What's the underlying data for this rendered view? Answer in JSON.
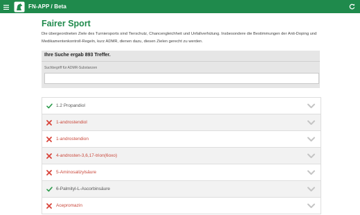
{
  "topbar": {
    "app_title": "FN-APP / Beta",
    "background": "#1f8a4c",
    "menu_icon": "hamburger-menu-icon",
    "logo_icon": "horse-logo-icon",
    "refresh_icon": "refresh-icon"
  },
  "main": {
    "title": "Fairer Sport",
    "intro": "Die übergeordneten Ziele des Turniersports sind Tierschutz, Chancengleichheit und Unfallverhütung. Insbesondere die Bestimmungen der Anti-Doping und Medikamentenkontroll-Regeln, kurz ADMR, dienen dazu, diesen Zielen gerecht zu werden."
  },
  "search": {
    "results_text": "Ihre Suche ergab 893 Treffer.",
    "label": "Suchbegriff für ADMR-Substanzen",
    "value": "",
    "placeholder": ""
  },
  "colors": {
    "allowed": "#2a9a4a",
    "banned": "#d9443a"
  },
  "substances": [
    {
      "name": "1.2 Propandiol",
      "status": "allowed"
    },
    {
      "name": "1-androstendiol",
      "status": "banned"
    },
    {
      "name": "1-androstendion",
      "status": "banned"
    },
    {
      "name": "4-androsten-3,6,17-trion(6oxo)",
      "status": "banned"
    },
    {
      "name": "5-Aminosalizylsäure",
      "status": "banned"
    },
    {
      "name": "6-Palmityl-L-Ascorbinsäure",
      "status": "allowed"
    },
    {
      "name": "Acepromazin",
      "status": "banned"
    }
  ]
}
